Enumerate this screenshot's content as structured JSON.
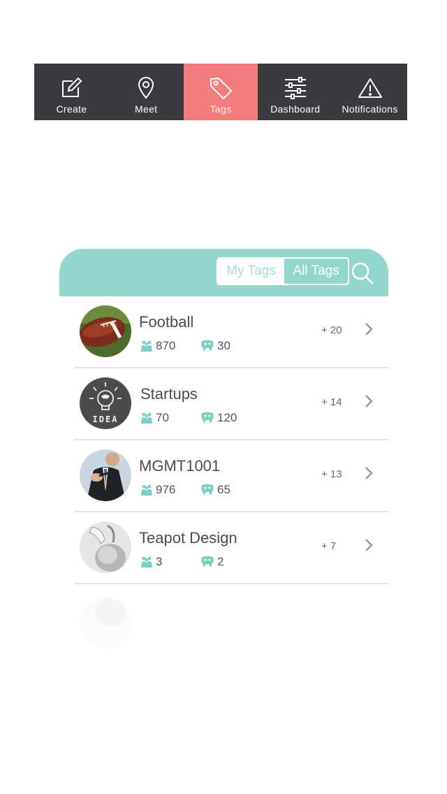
{
  "nav": {
    "items": [
      {
        "label": "Create",
        "icon": "edit-icon",
        "active": false
      },
      {
        "label": "Meet",
        "icon": "location-pin-icon",
        "active": false
      },
      {
        "label": "Tags",
        "icon": "tag-icon",
        "active": true
      },
      {
        "label": "Dashboard",
        "icon": "sliders-icon",
        "active": false
      },
      {
        "label": "Notifications",
        "icon": "warning-icon",
        "active": false
      }
    ]
  },
  "colors": {
    "nav_bg": "#3a3b3f",
    "nav_active": "#f47c7d",
    "accent": "#93d6cd"
  },
  "tags_panel": {
    "segments": {
      "my_tags": "My Tags",
      "all_tags": "All Tags",
      "selected": "All Tags"
    },
    "search_icon": "search-icon",
    "rows": [
      {
        "name": "Football",
        "members": "870",
        "posts": "30",
        "delta": "+ 20",
        "avatar": "football-avatar"
      },
      {
        "name": "Startups",
        "members": "70",
        "posts": "120",
        "delta": "+ 14",
        "avatar": "idea-lightbulb-avatar"
      },
      {
        "name": "MGMT1001",
        "members": "976",
        "posts": "65",
        "delta": "+ 13",
        "avatar": "businessman-avatar"
      },
      {
        "name": "Teapot Design",
        "members": "3",
        "posts": "2",
        "delta": "+ 7",
        "avatar": "teapot-avatar"
      }
    ]
  }
}
